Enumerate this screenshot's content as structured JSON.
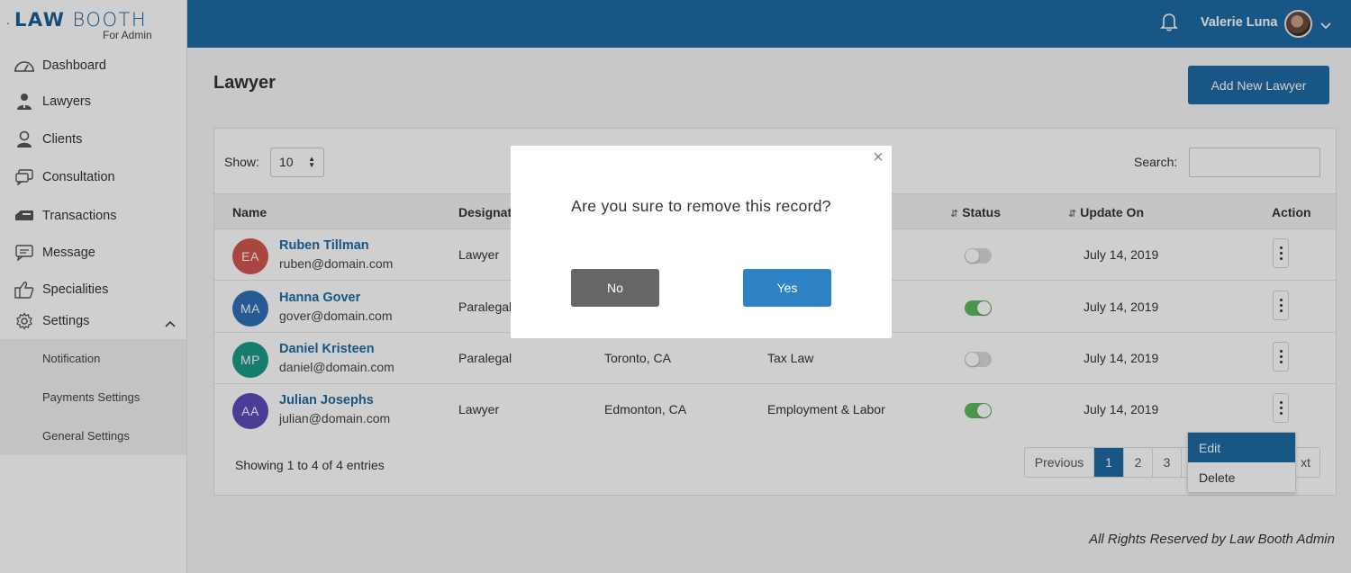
{
  "brand": {
    "logo_part1": "LAW",
    "logo_part2": "BOOTH",
    "subtitle": "For Admin"
  },
  "sidebar": {
    "items": [
      {
        "label": "Dashboard",
        "icon": "dashboard-icon"
      },
      {
        "label": "Lawyers",
        "icon": "lawyer-icon"
      },
      {
        "label": "Clients",
        "icon": "client-icon"
      },
      {
        "label": "Consultation",
        "icon": "consultation-icon"
      },
      {
        "label": "Transactions",
        "icon": "transactions-icon"
      },
      {
        "label": "Message",
        "icon": "message-icon"
      },
      {
        "label": "Specialities",
        "icon": "thumbs-up-icon"
      },
      {
        "label": "Settings",
        "icon": "gear-icon"
      }
    ],
    "settings_subitems": [
      "Notification",
      "Payments Settings",
      "General Settings"
    ]
  },
  "header": {
    "user_name": "Valerie Luna"
  },
  "page": {
    "title": "Lawyer",
    "add_button": "Add New Lawyer"
  },
  "table": {
    "show_label": "Show:",
    "show_value": "10",
    "search_label": "Search:",
    "columns": {
      "name": "Name",
      "designation": "Designati",
      "status": "Status",
      "update_on": "Update On",
      "action": "Action"
    },
    "rows": [
      {
        "initials": "EA",
        "avatar_color": "#d2564f",
        "name": "Ruben Tillman",
        "email": "ruben@domain.com",
        "designation": "Lawyer",
        "location": "",
        "speciality": "",
        "status_on": false,
        "updated": "July 14, 2019"
      },
      {
        "initials": "MA",
        "avatar_color": "#2f6fb6",
        "name": "Hanna Gover",
        "email": "gover@domain.com",
        "designation": "Paralegal",
        "location": "",
        "speciality": "",
        "status_on": true,
        "updated": "July 14, 2019"
      },
      {
        "initials": "MP",
        "avatar_color": "#1c9a86",
        "name": "Daniel Kristeen",
        "email": "daniel@domain.com",
        "designation": "Paralegal",
        "location": "Toronto, CA",
        "speciality": "Tax Law",
        "status_on": false,
        "updated": "July 14, 2019"
      },
      {
        "initials": "AA",
        "avatar_color": "#5b4cb8",
        "name": "Julian Josephs",
        "email": "julian@domain.com",
        "designation": "Lawyer",
        "location": "Edmonton, CA",
        "speciality": "Employment & Labor",
        "status_on": true,
        "updated": "July 14, 2019"
      }
    ],
    "showing_text": "Showing 1 to 4 of 4 entries",
    "pager": {
      "previous": "Previous",
      "pages": [
        "1",
        "2",
        "3"
      ],
      "next": "xt"
    }
  },
  "action_menu": {
    "edit": "Edit",
    "delete": "Delete"
  },
  "footer": {
    "text": "All Rights Reserved by Law Booth Admin"
  },
  "modal": {
    "message": "Are you sure to remove this record?",
    "no_label": "No",
    "yes_label": "Yes",
    "close_glyph": "×"
  },
  "colors": {
    "primary": "#1d6aa4",
    "toggle_on": "#5fb85a",
    "no_button": "#666666",
    "yes_button": "#2d83c5"
  }
}
